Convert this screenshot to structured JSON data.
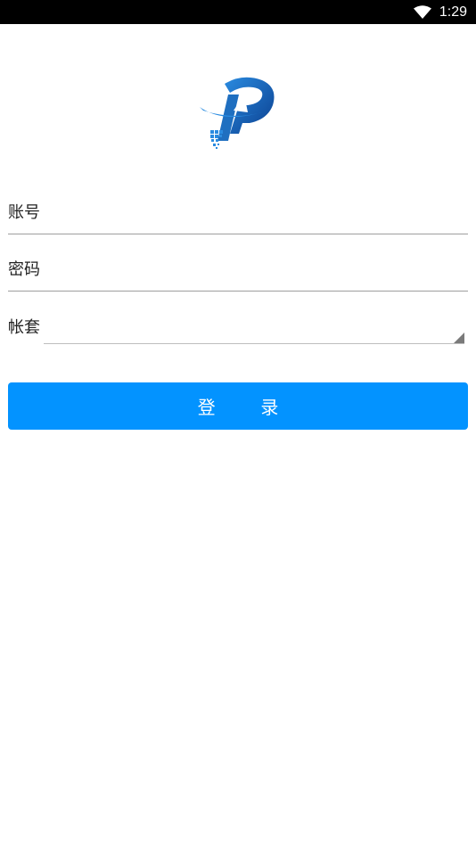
{
  "status_bar": {
    "time": "1:29",
    "wifi_icon": "wifi-icon"
  },
  "logo": {
    "icon": "app-logo-icon",
    "colors": [
      "#1f78c8",
      "#0b3f8f"
    ]
  },
  "form": {
    "account_label": "账号",
    "password_label": "密码",
    "account_set_label": "帐套"
  },
  "login": {
    "label": "登        录",
    "background": "#0393ff"
  }
}
